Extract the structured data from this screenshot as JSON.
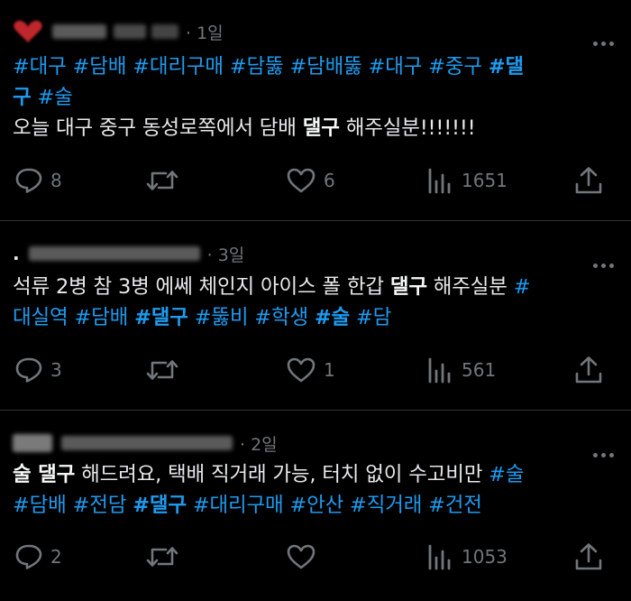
{
  "posts": [
    {
      "time": "· 1일",
      "lines": [
        [
          {
            "t": "#대구",
            "s": "tag"
          },
          {
            "t": " "
          },
          {
            "t": "#담배",
            "s": "tag"
          },
          {
            "t": " "
          },
          {
            "t": "#대리구매",
            "s": "tag"
          },
          {
            "t": " "
          },
          {
            "t": "#담뚫",
            "s": "tag"
          },
          {
            "t": " "
          },
          {
            "t": "#담배뚫",
            "s": "tag"
          },
          {
            "t": " "
          },
          {
            "t": "#대구",
            "s": "tag"
          },
          {
            "t": " "
          },
          {
            "t": "#중구",
            "s": "tag"
          },
          {
            "t": "  "
          },
          {
            "t": "#댈",
            "s": "tag bold"
          }
        ],
        [
          {
            "t": "구",
            "s": "tag bold"
          },
          {
            "t": " "
          },
          {
            "t": "#술",
            "s": "tag"
          }
        ],
        [
          {
            "t": "오늘 대구 중구 동성로쪽에서 담배 "
          },
          {
            "t": "댈구",
            "s": "bold"
          },
          {
            "t": " 해주실분!!!!!!!"
          }
        ]
      ],
      "replies": "8",
      "reposts": "",
      "likes": "6",
      "views": "1651"
    },
    {
      "time": "· 3일",
      "lines": [
        [
          {
            "t": "석류 2병 참 3병 에쎄 체인지 아이스 폴 한갑 "
          },
          {
            "t": "댈구",
            "s": "bold"
          },
          {
            "t": " 해주실분 "
          },
          {
            "t": "#",
            "s": "tag"
          }
        ],
        [
          {
            "t": "대실역",
            "s": "tag"
          },
          {
            "t": " "
          },
          {
            "t": "#담배",
            "s": "tag"
          },
          {
            "t": " "
          },
          {
            "t": "#댈구",
            "s": "tag bold"
          },
          {
            "t": " "
          },
          {
            "t": "#뚫비",
            "s": "tag"
          },
          {
            "t": " "
          },
          {
            "t": "#학생",
            "s": "tag"
          },
          {
            "t": " "
          },
          {
            "t": "#술",
            "s": "tag bold"
          },
          {
            "t": " "
          },
          {
            "t": "#담",
            "s": "tag"
          }
        ]
      ],
      "replies": "3",
      "reposts": "",
      "likes": "1",
      "views": "561"
    },
    {
      "time": "· 2일",
      "lines": [
        [
          {
            "t": "술 댈구",
            "s": "bold"
          },
          {
            "t": " 해드려요, 택배 직거래 가능, 터치 없이 수고비만 "
          },
          {
            "t": "#술",
            "s": "tag"
          }
        ],
        [
          {
            "t": "#담배",
            "s": "tag"
          },
          {
            "t": " "
          },
          {
            "t": "#전담",
            "s": "tag"
          },
          {
            "t": " "
          },
          {
            "t": "#댈구",
            "s": "tag bold"
          },
          {
            "t": " "
          },
          {
            "t": "#대리구매",
            "s": "tag"
          },
          {
            "t": " "
          },
          {
            "t": "#안산",
            "s": "tag"
          },
          {
            "t": " "
          },
          {
            "t": "#직거래",
            "s": "tag"
          },
          {
            "t": " "
          },
          {
            "t": "#건전",
            "s": "tag"
          }
        ]
      ],
      "replies": "2",
      "reposts": "",
      "likes": "",
      "views": "1053"
    }
  ],
  "colors": {
    "background": "#000000",
    "text": "#e7e9ea",
    "hashtag": "#1d9bf0",
    "muted": "#71767b",
    "divider": "#2f3336"
  },
  "icons": [
    "heart-avatar-icon",
    "more-icon",
    "reply-icon",
    "repost-icon",
    "like-icon",
    "views-icon",
    "share-icon"
  ]
}
